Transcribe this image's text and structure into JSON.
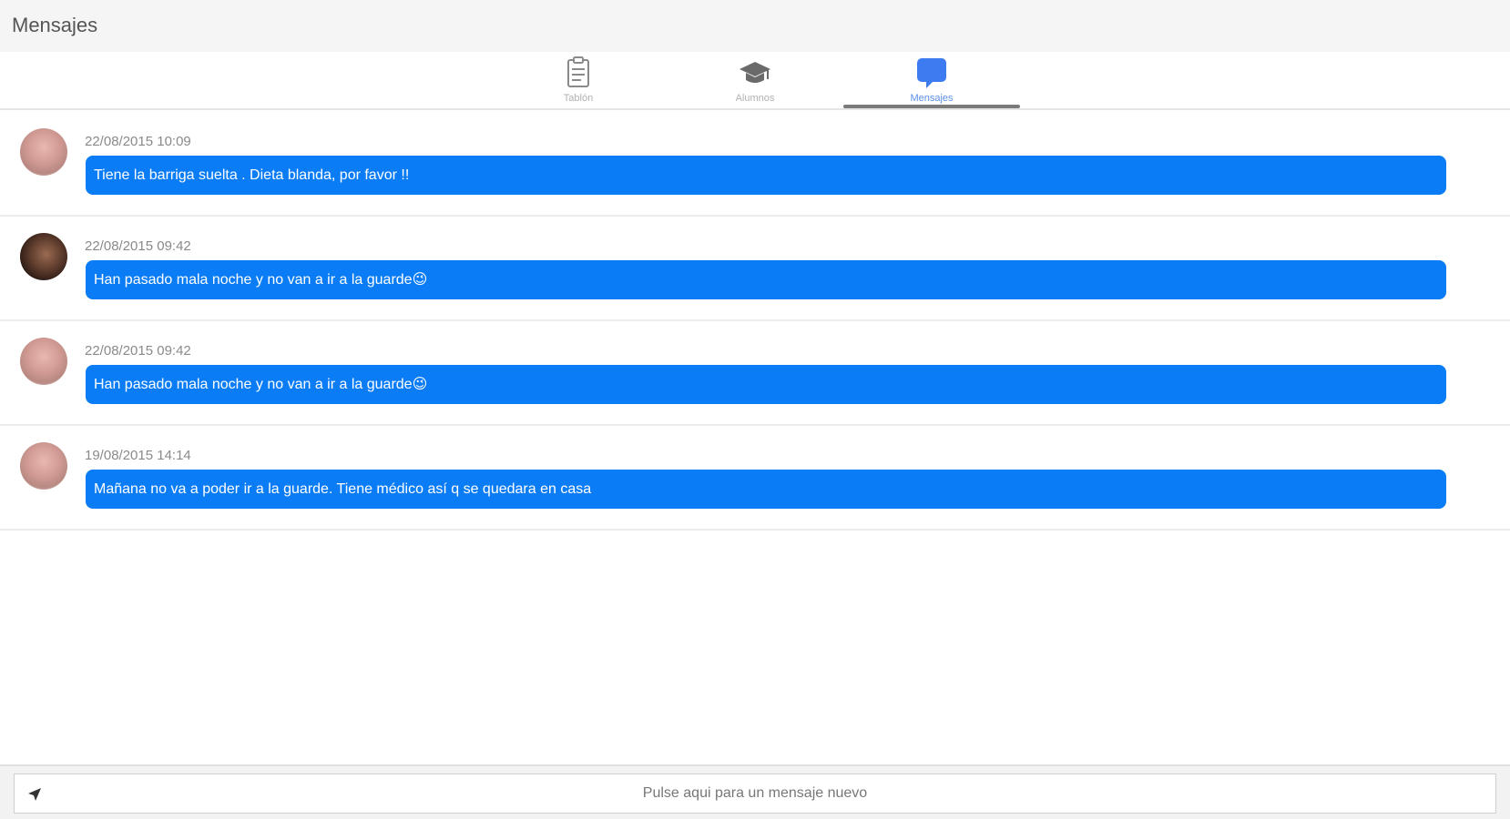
{
  "header": {
    "title": "Mensajes"
  },
  "tabs": [
    {
      "label": "Tablón",
      "icon": "clipboard-icon"
    },
    {
      "label": "Alumnos",
      "icon": "graduation-cap-icon"
    },
    {
      "label": "Mensajes",
      "icon": "chat-bubble-icon",
      "active": true
    }
  ],
  "colors": {
    "accent": "#0a7cf5",
    "tab_active": "#3d7cf0"
  },
  "messages": [
    {
      "time": "22/08/2015 10:09",
      "text": "Tiene la barriga suelta . Dieta blanda, por favor !!",
      "avatar": "avatar"
    },
    {
      "time": "22/08/2015 09:42",
      "text": "Han pasado mala noche y no van a ir a la guarde😉",
      "avatar": "avatar"
    },
    {
      "time": "22/08/2015 09:42",
      "text": "Han pasado mala noche y no van a ir a la guarde😉",
      "avatar": "avatar"
    },
    {
      "time": "19/08/2015 14:14",
      "text": "Mañana no va a poder ir a la guarde. Tiene médico así q se quedara en casa",
      "avatar": "avatar"
    }
  ],
  "compose": {
    "placeholder": "Pulse aqui para un mensaje nuevo",
    "icon": "send-icon"
  }
}
